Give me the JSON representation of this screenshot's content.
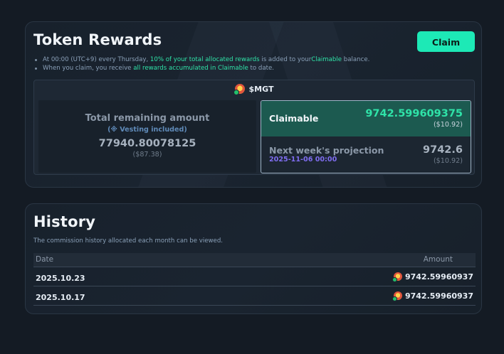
{
  "rewards": {
    "title": "Token Rewards",
    "claim_button": "Claim",
    "notes": [
      {
        "pre": "At 00:00 (UTC+9) every Thursday, ",
        "highlight": "10% of your total allocated rewards",
        "mid": " is added to your",
        "highlight2": "Claimable",
        "post": " balance."
      },
      {
        "pre": "When you claim, you receive ",
        "highlight": "all rewards accumulated in Claimable",
        "post": " to date."
      }
    ],
    "token_symbol": "$MGT",
    "total_remaining": {
      "label": "Total remaining amount",
      "sub": "(※ Vesting included)",
      "amount": "77940.80078125",
      "usd": "($87.38)"
    },
    "claimable": {
      "label": "Claimable",
      "amount": "9742.599609375",
      "usd": "($10.92)"
    },
    "projection": {
      "label": "Next week's projection",
      "date": "2025-11-06 00:00",
      "amount": "9742.6",
      "usd": "($10.92)"
    },
    "colors": {
      "accent": "#1de9b6",
      "highlight": "#2fe3a8",
      "projection_date": "#7f6df0"
    }
  },
  "history": {
    "title": "History",
    "description": "The commission history allocated each month can be viewed.",
    "columns": [
      "Date",
      "Amount"
    ],
    "rows": [
      {
        "date": "2025.10.23",
        "amount": "9742.59960937"
      },
      {
        "date": "2025.10.17",
        "amount": "9742.59960937"
      }
    ]
  }
}
